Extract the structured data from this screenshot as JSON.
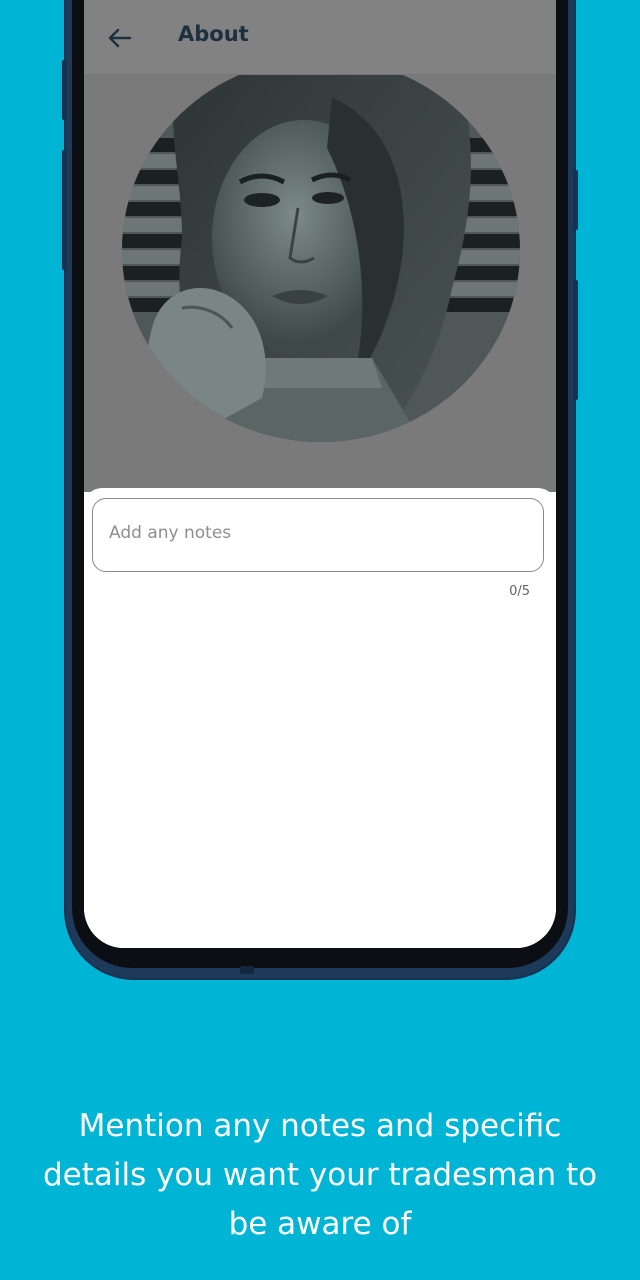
{
  "app": {
    "title": "About",
    "back_icon": "arrow-left-icon"
  },
  "profile": {
    "photo": "portrait-woman-grayscale"
  },
  "notes": {
    "placeholder": "Add any notes",
    "counter": "0/5"
  },
  "caption": {
    "lines": [
      "Mention any notes and specific",
      "details you want your tradesman to",
      "be aware of"
    ]
  },
  "colors": {
    "background": "#00b4d6",
    "phone_frame": "#1d3a5b",
    "title_text": "#1c3040"
  }
}
